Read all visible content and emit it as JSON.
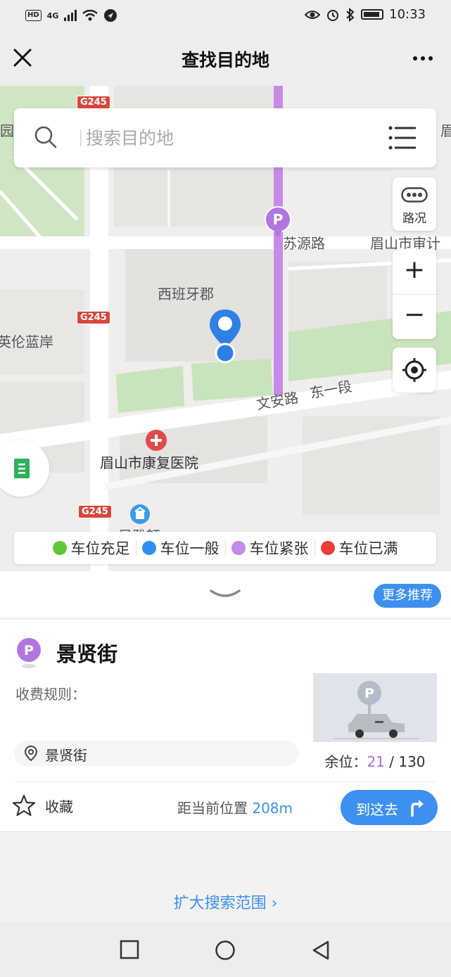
{
  "status_bar": {
    "network": "4G",
    "hd_label": "HD",
    "time": "10:33"
  },
  "header": {
    "title": "查找目的地"
  },
  "search": {
    "placeholder": "搜索目的地"
  },
  "map": {
    "labels": {
      "road_suyuan": "苏源路",
      "district_xibanya": "西班牙郡",
      "road_wenan": "文安路",
      "road_dongyiduan": "东一段",
      "hospital": "眉山市康复医院",
      "audit": "眉山市审计",
      "lanan": "英伦蓝岸",
      "fengya": "风雅轩",
      "yuan": "园",
      "mei": "眉",
      "highway": "G245"
    },
    "controls": {
      "traffic": "路况"
    }
  },
  "legend": [
    {
      "label": "车位充足",
      "color": "#5cc83a"
    },
    {
      "label": "车位一般",
      "color": "#2f8ff0"
    },
    {
      "label": "车位紧张",
      "color": "#c48be8"
    },
    {
      "label": "车位已满",
      "color": "#ee3b3b"
    }
  ],
  "sheet": {
    "more_button": "更多推荐"
  },
  "card": {
    "name": "景贤街",
    "fee_label": "收费规则：",
    "address": "景贤街",
    "remain_label": "余位：",
    "remain_available": "21",
    "remain_sep": " / ",
    "remain_total": "130",
    "favorite": "收藏",
    "distance_label": "距当前位置 ",
    "distance_value": "208m",
    "go_button": "到这去"
  },
  "footer": {
    "expand_link": "扩大搜索范围 ›"
  }
}
